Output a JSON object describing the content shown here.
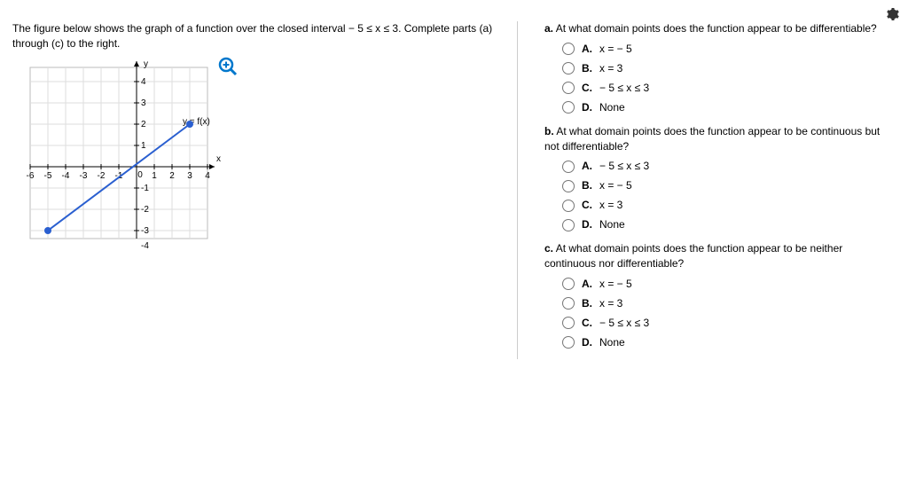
{
  "prompt": "The figure below shows the graph of a function over the closed interval − 5 ≤ x ≤ 3. Complete parts (a) through (c) to the right.",
  "chart_data": {
    "type": "line",
    "xlabel": "x",
    "ylabel": "y",
    "function_label": "y = f(x)",
    "xlim": [
      -6,
      4
    ],
    "ylim": [
      -4,
      4
    ],
    "xticks": [
      -6,
      -5,
      -4,
      -3,
      -2,
      -1,
      0,
      1,
      2,
      3,
      4
    ],
    "yticks": [
      -4,
      -3,
      -2,
      -1,
      1,
      2,
      3,
      4
    ],
    "series": [
      {
        "name": "f(x)",
        "x": [
          -5,
          3
        ],
        "y": [
          -3,
          2
        ],
        "endpoints": "closed"
      }
    ]
  },
  "sections": [
    {
      "label": "a.",
      "text": "At what domain points does the function appear to be differentiable?",
      "options": [
        {
          "letter": "A.",
          "text": "x = − 5"
        },
        {
          "letter": "B.",
          "text": "x = 3"
        },
        {
          "letter": "C.",
          "text": "− 5 ≤ x ≤ 3"
        },
        {
          "letter": "D.",
          "text": "None"
        }
      ]
    },
    {
      "label": "b.",
      "text": "At what domain points does the function appear to be continuous but not differentiable?",
      "options": [
        {
          "letter": "A.",
          "text": "− 5 ≤ x ≤ 3"
        },
        {
          "letter": "B.",
          "text": "x = − 5"
        },
        {
          "letter": "C.",
          "text": "x = 3"
        },
        {
          "letter": "D.",
          "text": "None"
        }
      ]
    },
    {
      "label": "c.",
      "text": "At what domain points does the function appear to be neither continuous nor differentiable?",
      "options": [
        {
          "letter": "A.",
          "text": "x = − 5"
        },
        {
          "letter": "B.",
          "text": "x = 3"
        },
        {
          "letter": "C.",
          "text": "− 5 ≤ x ≤ 3"
        },
        {
          "letter": "D.",
          "text": "None"
        }
      ]
    }
  ]
}
